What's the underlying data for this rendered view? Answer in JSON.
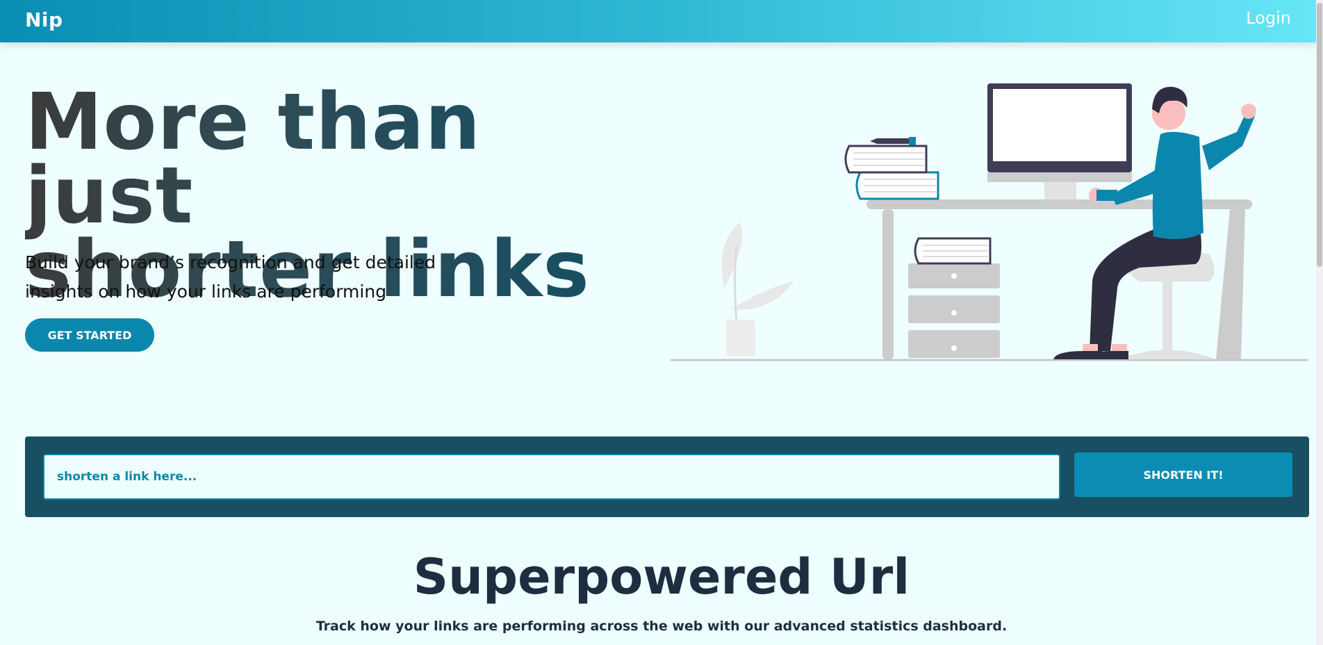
{
  "navbar": {
    "logo": "Nip",
    "login_label": "Login"
  },
  "hero": {
    "title_line1": "More than just",
    "title_line2": "shorter links",
    "subtitle_line1": "Build your brand’s recognition and get detailed",
    "subtitle_line2": "insights on how your links are performing",
    "cta_label": "GET STARTED"
  },
  "shortener": {
    "placeholder": "shorten a link here...",
    "button_label": "SHORTEN IT!"
  },
  "features": {
    "title": "Superpowered Url",
    "subtitle": "Track how your links are performing across the web with our advanced statistics dashboard."
  },
  "colors": {
    "primary": "#0b87ad",
    "dark": "#184f63",
    "background": "#effefe",
    "heading": "#1e2e40"
  },
  "illustration": {
    "name": "person-at-desk-illustration"
  }
}
